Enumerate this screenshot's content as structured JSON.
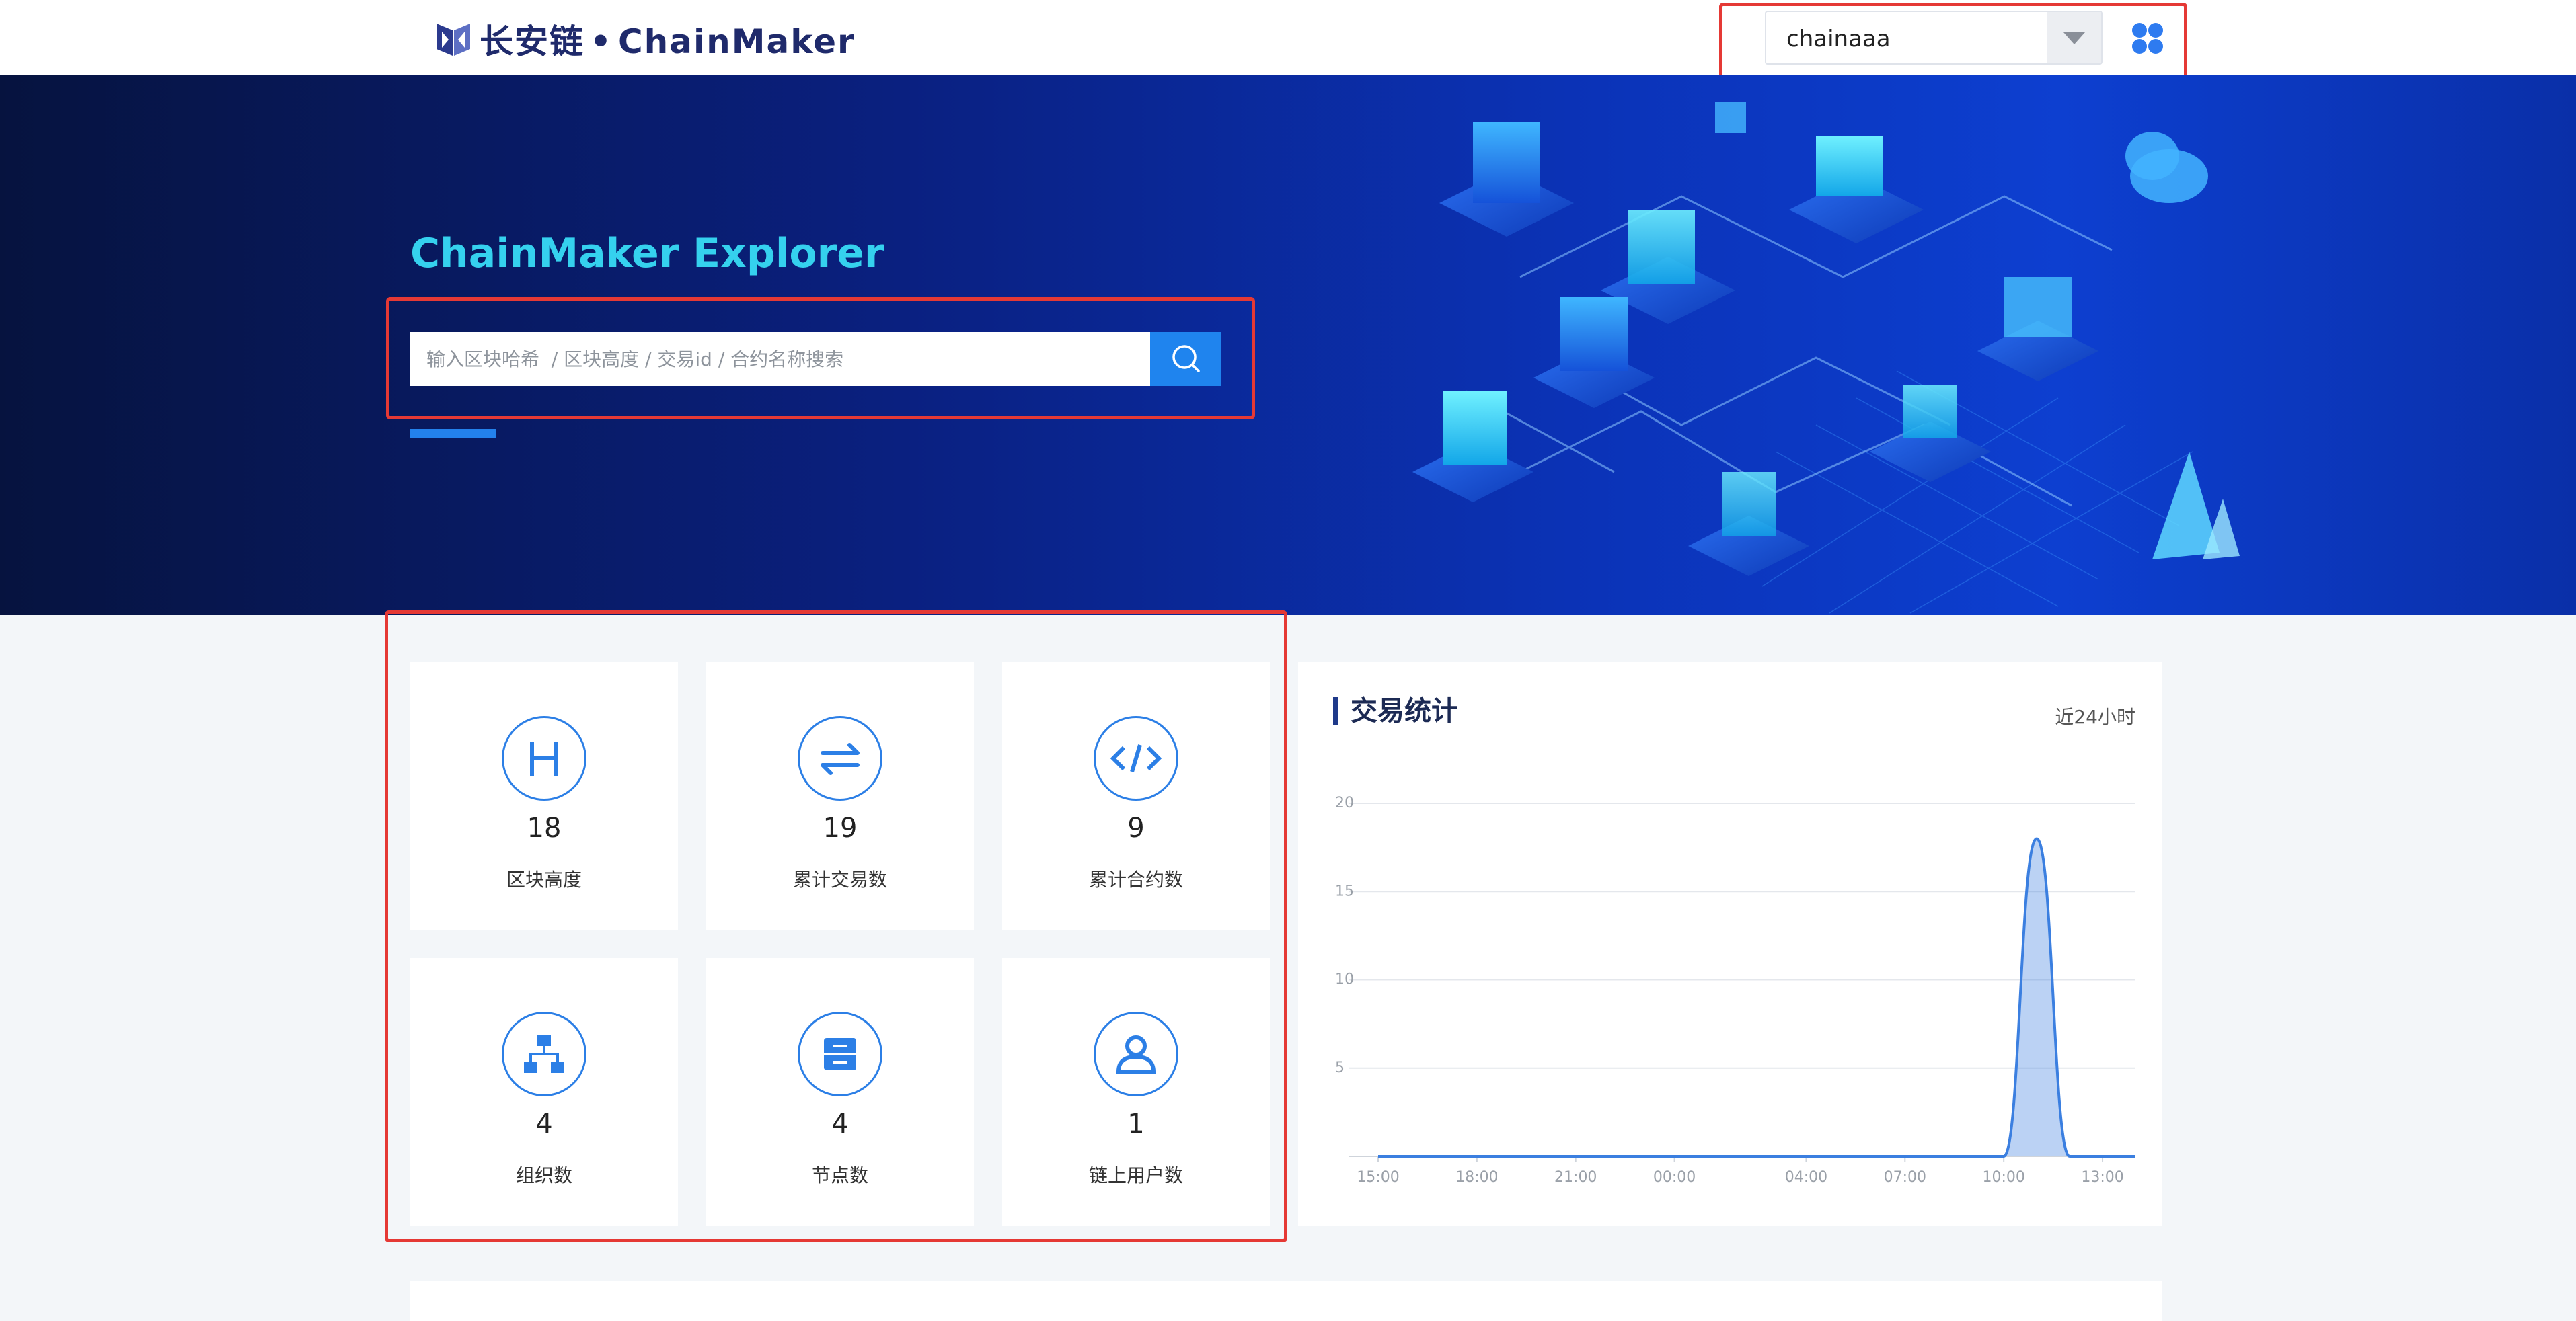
{
  "header": {
    "logo_text": "长安链",
    "logo_brand": "ChainMaker",
    "chain_selected": "chainaaa",
    "menu_icon": "grid-menu-icon"
  },
  "hero": {
    "title": "ChainMaker Explorer",
    "search_placeholder": "输入区块哈希  / 区块高度 / 交易id / 合约名称搜索"
  },
  "stats": [
    {
      "icon": "block-height-icon",
      "value": "18",
      "label": "区块高度"
    },
    {
      "icon": "transactions-icon",
      "value": "19",
      "label": "累计交易数"
    },
    {
      "icon": "contract-code-icon",
      "value": "9",
      "label": "累计合约数"
    },
    {
      "icon": "organization-icon",
      "value": "4",
      "label": "组织数"
    },
    {
      "icon": "node-server-icon",
      "value": "4",
      "label": "节点数"
    },
    {
      "icon": "user-icon",
      "value": "1",
      "label": "链上用户数"
    }
  ],
  "chart_panel": {
    "title": "交易统计",
    "range": "近24小时"
  },
  "chart_data": {
    "type": "area",
    "title": "",
    "ylim": [
      0,
      20
    ],
    "yticks": [
      5,
      10,
      15,
      20
    ],
    "xticks": [
      "15:00",
      "18:00",
      "21:00",
      "00:00",
      "04:00",
      "07:00",
      "10:00",
      "13:00"
    ],
    "series": [
      {
        "x": [
          "15:00",
          "16:00",
          "17:00",
          "18:00",
          "19:00",
          "20:00",
          "21:00",
          "22:00",
          "23:00",
          "00:00",
          "01:00",
          "02:00",
          "03:00",
          "04:00",
          "05:00",
          "06:00",
          "07:00",
          "08:00",
          "09:00",
          "10:00",
          "11:00",
          "12:00",
          "13:00",
          "14:00"
        ],
        "values": [
          0,
          0,
          0,
          0,
          0,
          0,
          0,
          0,
          0,
          0,
          0,
          0,
          0,
          0,
          0,
          0,
          0,
          0,
          0,
          0,
          18,
          0,
          0,
          0
        ]
      }
    ],
    "grid": true,
    "color": "#3b7fe0"
  },
  "colors": {
    "accent": "#2c7fe6",
    "hero_title": "#35d1ee",
    "highlight_box": "#e53935"
  }
}
